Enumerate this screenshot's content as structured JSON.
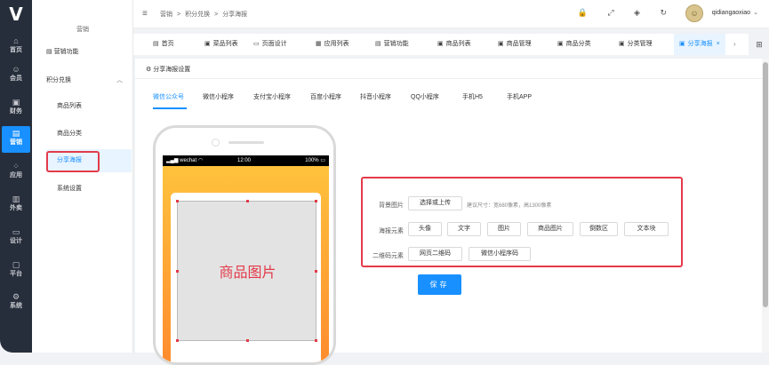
{
  "rail": {
    "logo": "V",
    "items": [
      {
        "icon": "⌂",
        "label": "首页"
      },
      {
        "icon": "☺",
        "label": "会员"
      },
      {
        "icon": "▣",
        "label": "财务"
      },
      {
        "icon": "▤",
        "label": "营销"
      },
      {
        "icon": "⁘",
        "label": "应用"
      },
      {
        "icon": "▥",
        "label": "外卖"
      },
      {
        "icon": "▭",
        "label": "设计"
      },
      {
        "icon": "▢",
        "label": "平台"
      },
      {
        "icon": "⚙",
        "label": "系统"
      }
    ]
  },
  "submenu": {
    "title": "营销",
    "title2": "营销功能",
    "group": "积分兑换",
    "items": [
      "商品列表",
      "商品分类",
      "分享海报",
      "系统设置"
    ]
  },
  "topbar": {
    "fold_icon": "≡",
    "breadcrumb": [
      "营销",
      ">",
      "积分兑换",
      ">",
      "分享海报"
    ],
    "icons": "🔒 ⤢ ◈ ↻",
    "username": "qidiangaoxiao",
    "caret": "⌄"
  },
  "tabs": [
    {
      "icon": "▤",
      "label": "首页"
    },
    {
      "icon": "▣",
      "label": "菜品列表"
    },
    {
      "icon": "▭",
      "label": "页面设计"
    },
    {
      "icon": "▦",
      "label": "应用列表"
    },
    {
      "icon": "▤",
      "label": "营销功能"
    },
    {
      "icon": "▣",
      "label": "商品列表"
    },
    {
      "icon": "▣",
      "label": "商品管理"
    },
    {
      "icon": "▣",
      "label": "商品分类"
    },
    {
      "icon": "▣",
      "label": "分类管理"
    },
    {
      "icon": "▣",
      "label": "分享海报",
      "close": "×"
    }
  ],
  "tabnav": {
    "left": "‹",
    "right": "›",
    "grid": "⊞"
  },
  "card": {
    "title": "分享海报设置",
    "platform_tabs": [
      "微信公众号",
      "微信小程序",
      "支付宝小程序",
      "百度小程序",
      "抖音小程序",
      "QQ小程序",
      "手机H5",
      "手机APP"
    ],
    "active_tab": 0
  },
  "phone": {
    "status_left": "wechat",
    "status_time": "12:00",
    "status_right": "100%",
    "product_label": "商品图片"
  },
  "form": {
    "bg_label": "背景图片",
    "bg_button": "选择或上传",
    "bg_hint": "建议尺寸：宽680像素，高1300像素",
    "elements_label": "海报元素",
    "elements": [
      "头像",
      "文字",
      "图片",
      "商品图片",
      "倒数区",
      "文本块"
    ],
    "qr_label": "二维码元素",
    "qr_buttons": [
      "网页二维码",
      "微信小程序码"
    ],
    "save": "保存"
  }
}
